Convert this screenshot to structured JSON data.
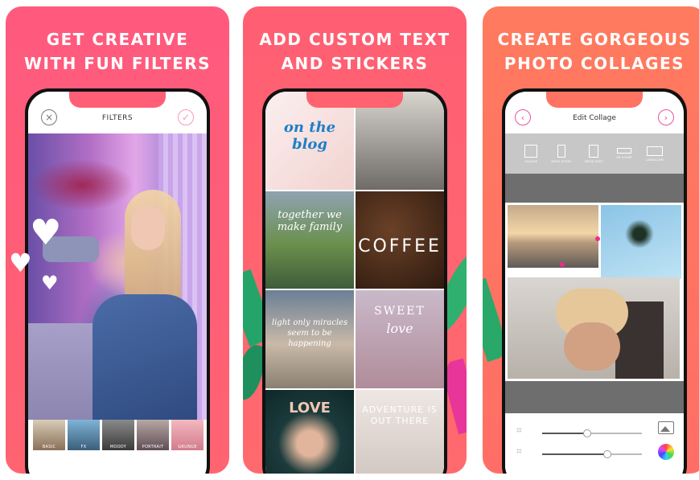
{
  "panels": [
    {
      "headline_line1": "GET CREATIVE",
      "headline_line2": "WITH FUN FILTERS",
      "screen_title": "FILTERS",
      "close_icon": "×",
      "check_icon": "✓",
      "filters": [
        "BASIC",
        "FX",
        "MOODY",
        "PORTRAIT",
        "GRUNGE"
      ]
    },
    {
      "headline_line1": "ADD CUSTOM TEXT",
      "headline_line2": "AND STICKERS",
      "stickers": {
        "blog": "on the blog",
        "together": "together we make family",
        "coffee": "COFFEE",
        "sweet": "SWEET",
        "love_script": "love",
        "quote": "light only miracles seem to be happening",
        "love": "LOVE",
        "adventure": "ADVENTURE IS OUT THERE"
      }
    },
    {
      "headline_line1": "CREATE GORGEOUS",
      "headline_line2": "PHOTO COLLAGES",
      "screen_title": "Edit Collage",
      "prev_icon": "‹",
      "next_icon": "›",
      "layouts": [
        "SQUARE",
        "INSTA STORY",
        "INSTA POST",
        "FB COVER",
        "LANDSCAPE"
      ],
      "slider1_value": 0.45,
      "slider2_value": 0.65
    }
  ],
  "colors": {
    "accent_pink": "#ec2d8d",
    "panel1_bg": "#ff5e77",
    "panel2_bg": "#ff636f",
    "panel3_bg": "#ff7363"
  }
}
